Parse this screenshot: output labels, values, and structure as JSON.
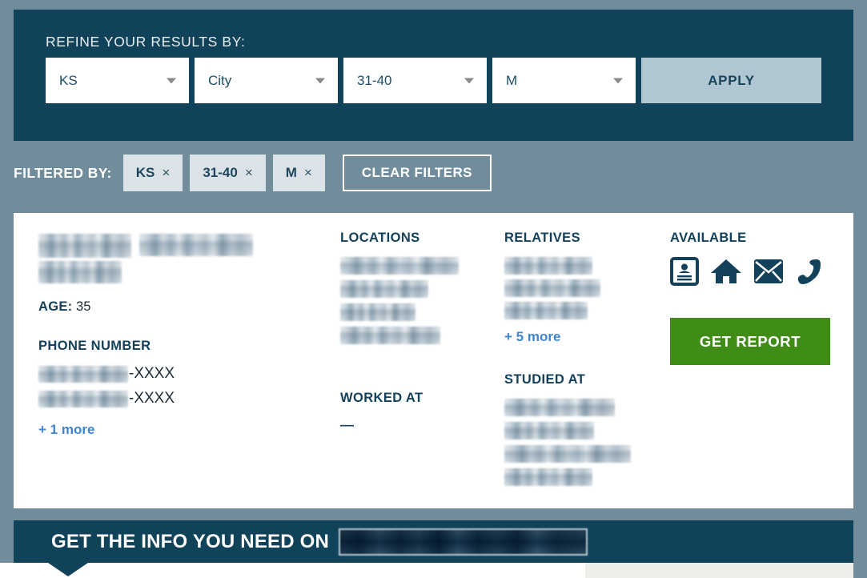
{
  "colors": {
    "page_background": "#718d9b",
    "panel_dark": "#104259",
    "apply_button": "#b0c7d2",
    "chip_background": "#dbe3e8",
    "link_blue": "#3d85ce",
    "get_report_green": "#3f8c16",
    "heading_navy": "#13405a"
  },
  "refine_panel": {
    "title": "REFINE YOUR RESULTS BY:",
    "selects": [
      {
        "name": "state",
        "value": "KS",
        "icon": "chevron-down-icon"
      },
      {
        "name": "city",
        "value": "City",
        "icon": "chevron-down-icon"
      },
      {
        "name": "age-range",
        "value": "31-40",
        "icon": "chevron-down-icon"
      },
      {
        "name": "gender",
        "value": "M",
        "icon": "chevron-down-icon"
      }
    ],
    "apply_label": "APPLY"
  },
  "filtered_by": {
    "label": "FILTERED BY:",
    "chips": [
      {
        "label": "KS",
        "remove": "×"
      },
      {
        "label": "31-40",
        "remove": "×"
      },
      {
        "label": "M",
        "remove": "×"
      }
    ],
    "clear_label": "CLEAR FILTERS"
  },
  "result_card": {
    "person": {
      "name_redacted": true,
      "age_label": "AGE:",
      "age_value": "35",
      "phone_heading": "PHONE NUMBER",
      "phones": [
        {
          "redacted_prefix": true,
          "suffix": "-XXXX"
        },
        {
          "redacted_prefix": true,
          "suffix": "-XXXX"
        }
      ],
      "phones_more_link": "+ 1 more"
    },
    "locations": {
      "heading": "LOCATIONS",
      "entries_redacted_count": 4
    },
    "relatives": {
      "heading": "RELATIVES",
      "entries_redacted_count": 3,
      "more_link": "+ 5 more"
    },
    "worked_at": {
      "heading": "WORKED AT",
      "value": "—"
    },
    "studied_at": {
      "heading": "STUDIED AT",
      "entries_redacted_count": 4
    },
    "available": {
      "heading": "AVAILABLE",
      "icons": [
        "id-card-icon",
        "home-icon",
        "envelope-icon",
        "phone-icon"
      ],
      "get_report_label": "GET REPORT"
    }
  },
  "bottom_banner": {
    "text": "GET THE INFO YOU NEED ON",
    "subject_redacted": true
  }
}
